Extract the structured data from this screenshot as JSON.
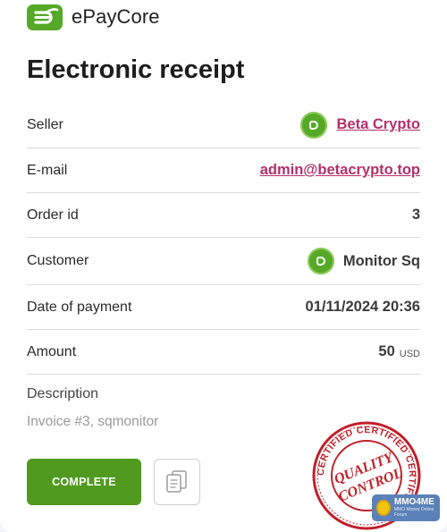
{
  "brand": {
    "name": "ePayCore",
    "color": "#4f9a1f"
  },
  "page_title": "Electronic receipt",
  "rows": {
    "seller": {
      "label": "Seller",
      "value": "Beta Crypto"
    },
    "email": {
      "label": "E-mail",
      "value": "admin@betacrypto.top"
    },
    "order": {
      "label": "Order id",
      "value": "3"
    },
    "customer": {
      "label": "Customer",
      "value": "Monitor Sq"
    },
    "date": {
      "label": "Date of payment",
      "value": "01/11/2024 20:36"
    },
    "amount": {
      "label": "Amount",
      "value": "50",
      "currency": "USD"
    }
  },
  "description": {
    "label": "Description",
    "text": "Invoice #3, sqmonitor"
  },
  "actions": {
    "complete_label": "COMPLETE",
    "copy_icon": "copy-icon"
  },
  "stamp": {
    "top_text": "CERTIFIED CERTIFIED CERTIFIED",
    "line1": "QUALITY",
    "line2": "CONTROL",
    "color": "#c0202a"
  },
  "watermark": {
    "text": "MMO4ME",
    "sub": "MMO Money Online Forum"
  },
  "link_color": "#b3306a"
}
